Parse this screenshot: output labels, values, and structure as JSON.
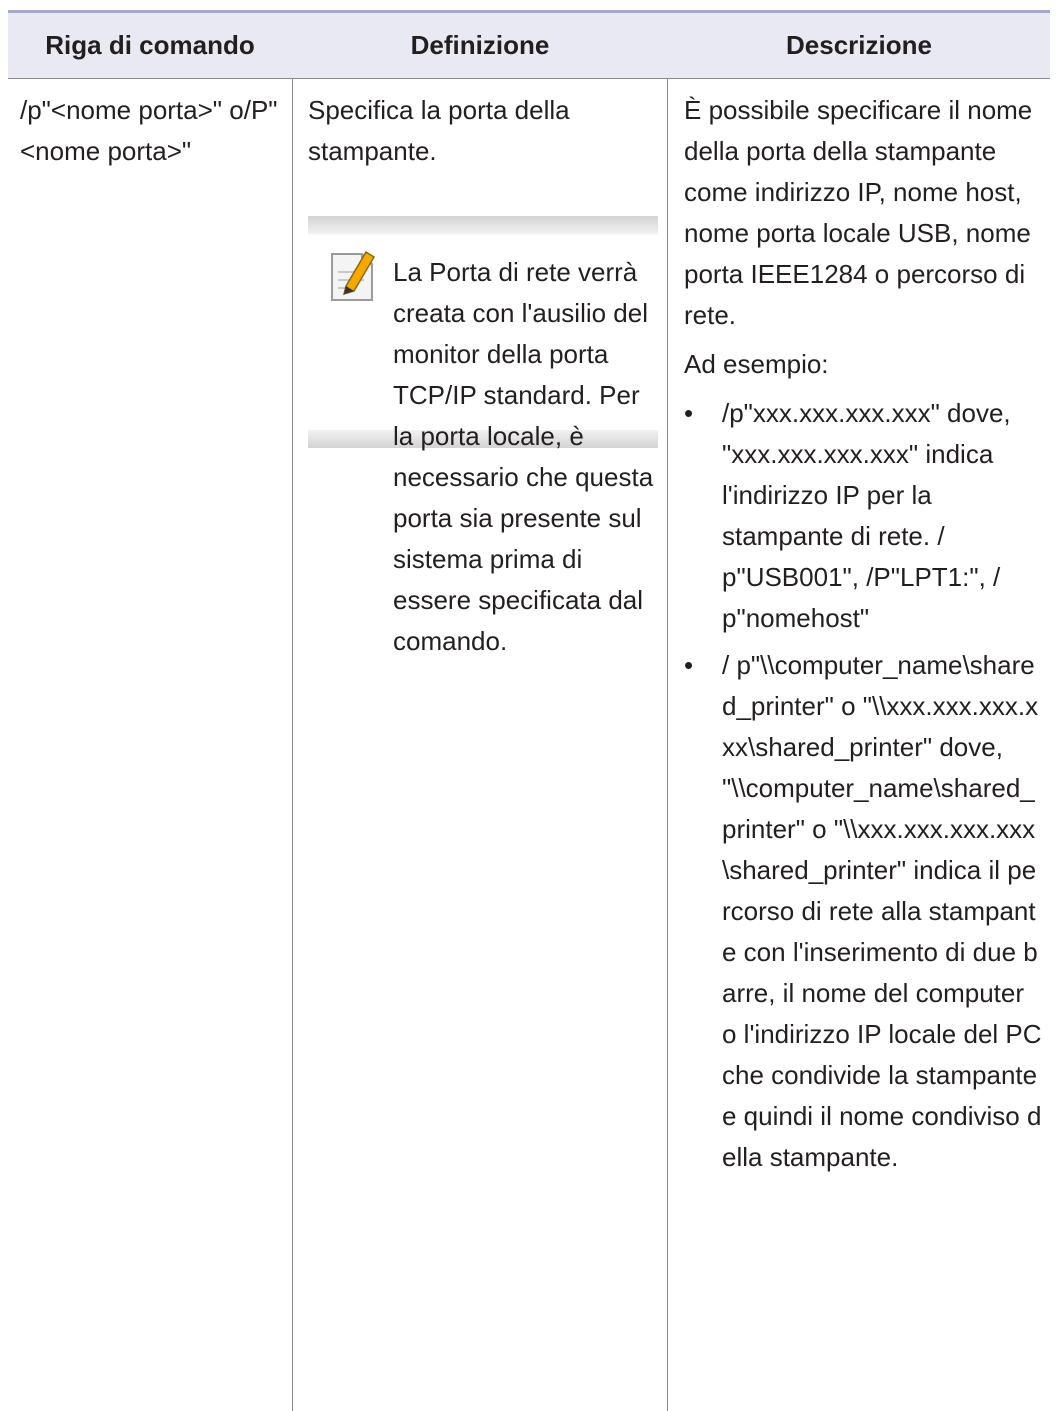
{
  "header": {
    "col1": "Riga di comando",
    "col2": "Definizione",
    "col3": "Descrizione"
  },
  "row": {
    "command": "/p\"<nome porta>\" o/P\"<nome porta>\"",
    "definition": "Specifica la porta della stampante.",
    "note": {
      "icon": "note-pencil-icon",
      "text": "La Porta di rete verrà creata con l'ausilio del monitor della porta TCP/IP standard. Per la porta locale, è necessario che questa porta sia presente sul sistema prima di essere specificata dal comando."
    },
    "description": {
      "intro": "È possibile specificare il nome della porta della stampante come indirizzo IP, nome host, nome porta locale USB, nome porta IEEE1284 o percorso di rete.",
      "example_label": "Ad esempio:",
      "items": [
        "/p\"xxx.xxx.xxx.xxx\" dove, \"xxx.xxx.xxx.xxx\" indica l'indirizzo IP per la stampante di rete. / p\"USB001\", /P\"LPT1:\", / p\"nomehost\"",
        "/ p\"\\\\computer_name\\shared_printer\" o \"\\\\xxx.xxx.xxx.xxx\\shared_printer\" dove, \"\\\\computer_name\\shared_printer\" o \"\\\\xxx.xxx.xxx.xxx\\shared_printer\" indica il percorso di rete alla stampante con l'inserimento di due barre, il nome del computer o l'indirizzo IP locale del PC che condivide la stampante e quindi il nome condiviso della stampante."
      ]
    }
  },
  "colors": {
    "header_bg": "#e9e9f3",
    "top_rule": "#a6a8c8",
    "text": "#231f20",
    "note_icon_accent": "#f5a800"
  }
}
